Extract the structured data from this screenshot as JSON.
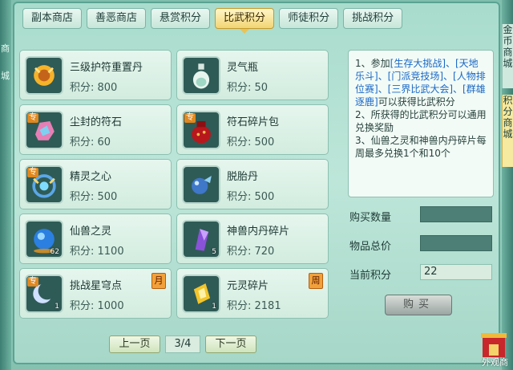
{
  "tabs": [
    {
      "label": "副本商店",
      "active": false
    },
    {
      "label": "善恶商店",
      "active": false
    },
    {
      "label": "悬赏积分",
      "active": false
    },
    {
      "label": "比武积分",
      "active": true
    },
    {
      "label": "师徒积分",
      "active": false
    },
    {
      "label": "挑战积分",
      "active": false
    }
  ],
  "items": [
    {
      "name": "三级护符重置丹",
      "price": "积分: 800",
      "icon": "amulet-reset-icon",
      "special": false,
      "qty": "",
      "limit": ""
    },
    {
      "name": "灵气瓶",
      "price": "积分: 50",
      "icon": "spirit-bottle-icon",
      "special": false,
      "qty": "",
      "limit": ""
    },
    {
      "name": "尘封的符石",
      "price": "积分: 60",
      "icon": "sealed-rune-stone-icon",
      "special": true,
      "qty": "",
      "limit": ""
    },
    {
      "name": "符石碎片包",
      "price": "积分: 500",
      "icon": "rune-fragment-bag-icon",
      "special": true,
      "qty": "",
      "limit": ""
    },
    {
      "name": "精灵之心",
      "price": "积分: 500",
      "icon": "spirit-heart-icon",
      "special": true,
      "qty": "",
      "limit": ""
    },
    {
      "name": "脱胎丹",
      "price": "积分: 500",
      "icon": "rebirth-pill-icon",
      "special": false,
      "qty": "",
      "limit": ""
    },
    {
      "name": "仙兽之灵",
      "price": "积分: 1100",
      "icon": "beast-soul-orb-icon",
      "special": false,
      "qty": "62",
      "limit": ""
    },
    {
      "name": "神兽内丹碎片",
      "price": "积分: 720",
      "icon": "beast-core-shard-icon",
      "special": false,
      "qty": "5",
      "limit": ""
    },
    {
      "name": "挑战星穹点",
      "price": "积分: 1000",
      "icon": "crescent-moon-icon",
      "special": true,
      "qty": "1",
      "limit": "月"
    },
    {
      "name": "元灵碎片",
      "price": "积分: 2181",
      "icon": "yuanling-fragment-icon",
      "special": false,
      "qty": "1",
      "limit": "周"
    }
  ],
  "special_badge": "专",
  "info": {
    "line1_pre": "1、参加",
    "line1_links": "[生存大挑战]、[天地乐斗]、[门派竞技场]、[人物排位赛]、[三界比武大会]、[群雄逐鹿]",
    "line1_post": "可以获得比武积分",
    "line2": "2、所获得的比武积分可以通用兑换奖励",
    "line3": "3、仙兽之灵和神兽内丹碎片每周最多兑换1个和10个"
  },
  "form": {
    "qty_label": "购买数量",
    "qty_value": "",
    "total_label": "物品总价",
    "total_value": "",
    "points_label": "当前积分",
    "points_value": "22"
  },
  "buy_button": "购买",
  "pager": {
    "prev": "上一页",
    "page": "3/4",
    "next": "下一页"
  },
  "side_tabs": {
    "top": "金币商城",
    "bottom": "积分商城"
  },
  "corner_label": "外观商",
  "left_edge_glyphs": [
    "商",
    "城"
  ],
  "colors": {
    "active_tab": "#f2d574",
    "link": "#1a68c7",
    "limit_tag": "#f2a13a"
  }
}
